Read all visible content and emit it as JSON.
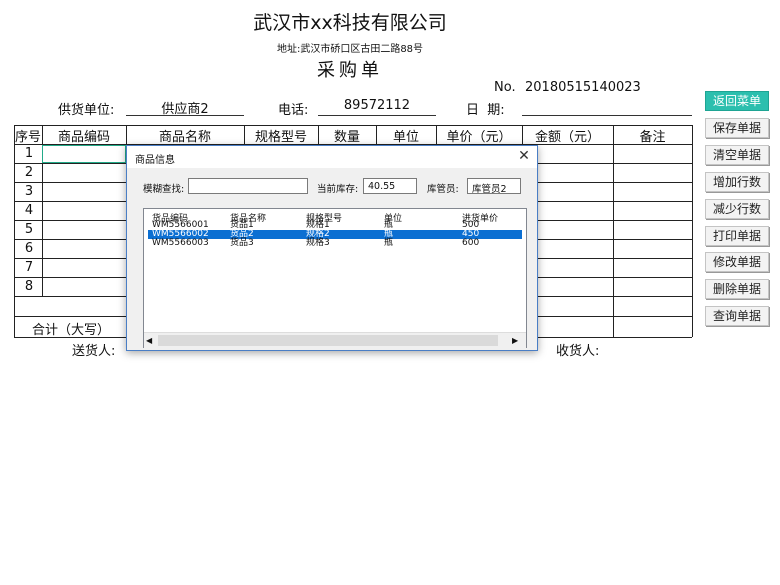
{
  "header": {
    "company": "武汉市xx科技有限公司",
    "address": "地址:武汉市硚口区古田二路88号",
    "title": "采购单",
    "no_label": "No.",
    "no_value": "20180515140023"
  },
  "info": {
    "supplier_label": "供货单位:",
    "supplier_value": "供应商2",
    "phone_label": "电话:",
    "phone_value": "89572112",
    "date_label": "日  期:",
    "date_value": ""
  },
  "table": {
    "headers": [
      "序号",
      "商品编码",
      "商品名称",
      "规格型号",
      "数量",
      "单位",
      "单价（元）",
      "金额（元）",
      "备注"
    ],
    "rows": [
      "1",
      "2",
      "3",
      "4",
      "5",
      "6",
      "7",
      "8"
    ],
    "total_label": "合计（大写）"
  },
  "footer": {
    "deliver_label": "送货人:",
    "receiver_label": "收货人:"
  },
  "buttons": {
    "return": "返回菜单",
    "save": "保存单据",
    "clear": "清空单据",
    "add_row": "增加行数",
    "remove_row": "减少行数",
    "print": "打印单据",
    "edit": "修改单据",
    "delete": "删除单据",
    "query": "查询单据"
  },
  "dialog": {
    "title": "商品信息",
    "fuzzy_label": "模糊查找:",
    "fuzzy_value": "",
    "stock_label": "当前库存:",
    "stock_value": "40.55",
    "keeper_label": "库管员:",
    "keeper_value": "库管员2",
    "columns": [
      "货品编码",
      "货品名称",
      "规格型号",
      "单位",
      "进货单价"
    ],
    "items": [
      {
        "code": "WM5566001",
        "name": "货品1",
        "spec": "规格1",
        "unit": "瓶",
        "price": "500"
      },
      {
        "code": "WM5566002",
        "name": "货品2",
        "spec": "规格2",
        "unit": "瓶",
        "price": "450"
      },
      {
        "code": "WM5566003",
        "name": "货品3",
        "spec": "规格3",
        "unit": "瓶",
        "price": "600"
      }
    ],
    "selected_index": 1
  },
  "colors": {
    "accent": "#2bbfae",
    "selection": "#0b6fd2",
    "dialog_border": "#4a7ec5"
  }
}
